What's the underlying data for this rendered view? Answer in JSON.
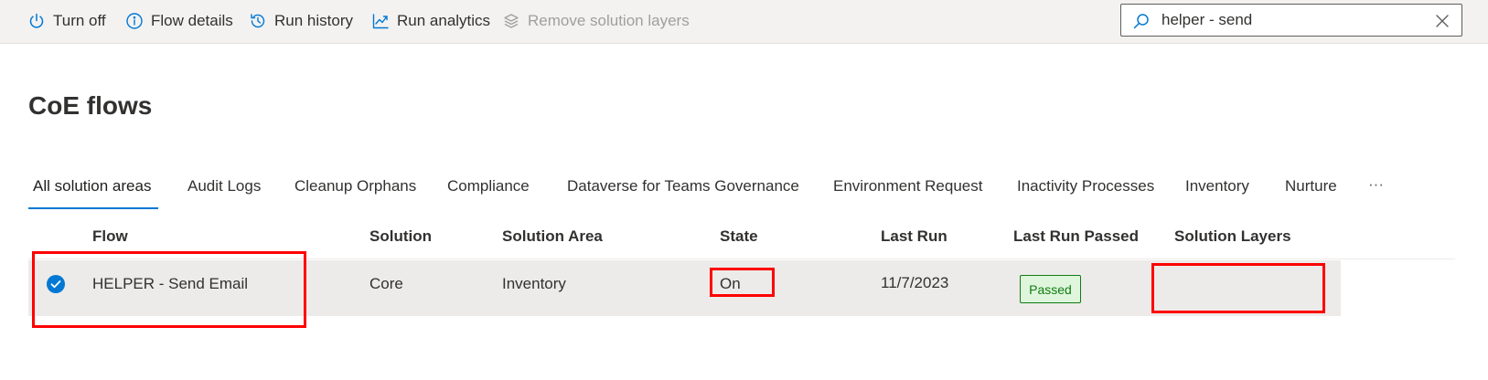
{
  "toolbar": {
    "turn_off": "Turn off",
    "flow_details": "Flow details",
    "run_history": "Run history",
    "run_analytics": "Run analytics",
    "remove_layers": "Remove solution layers"
  },
  "search": {
    "value": "helper - send"
  },
  "page": {
    "title": "CoE flows"
  },
  "tabs": [
    "All solution areas",
    "Audit Logs",
    "Cleanup Orphans",
    "Compliance",
    "Dataverse for Teams Governance",
    "Environment Request",
    "Inactivity Processes",
    "Inventory",
    "Nurture",
    "···"
  ],
  "table": {
    "columns": [
      "Flow",
      "Solution",
      "Solution Area",
      "State",
      "Last Run",
      "Last Run Passed",
      "Solution Layers"
    ],
    "rows": [
      {
        "flow": "HELPER - Send Email",
        "solution": "Core",
        "area": "Inventory",
        "state": "On",
        "last_run": "11/7/2023",
        "passed": "Passed",
        "layers": ""
      }
    ]
  },
  "colors": {
    "accent": "#0078d4",
    "success": "#107c10",
    "highlight": "#ff0000"
  }
}
